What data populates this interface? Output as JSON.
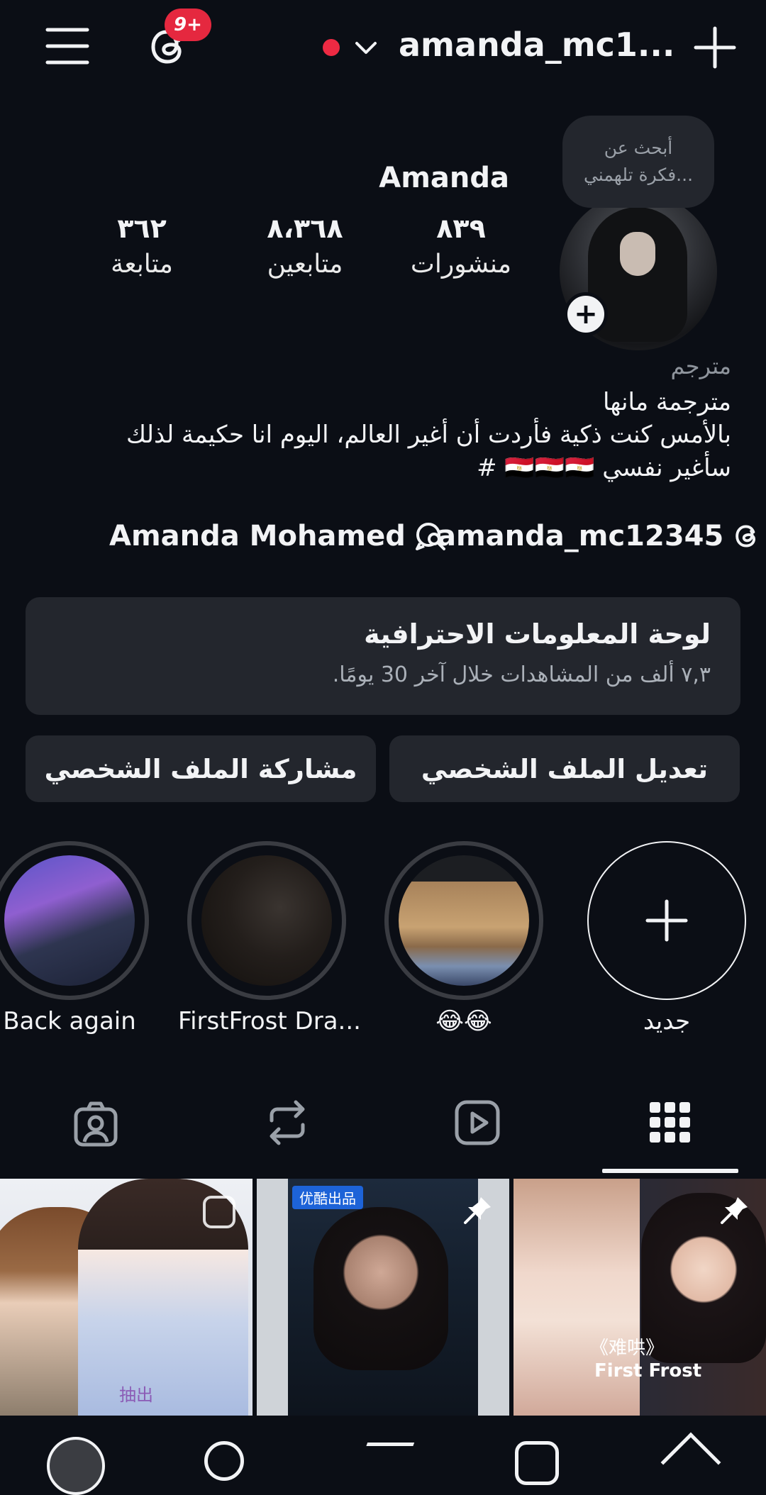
{
  "header": {
    "notification_badge": "9+",
    "username": "amanda_mc1..."
  },
  "note": {
    "line1": "أبحث عن",
    "line2": "فكرة تلهمني..."
  },
  "profile": {
    "display_name": "Amanda",
    "stats": {
      "posts": {
        "value": "٨٣٩",
        "label": "منشورات"
      },
      "followers": {
        "value": "٨،٣٦٨",
        "label": "متابعين"
      },
      "following": {
        "value": "٣٦٢",
        "label": "متابعة"
      }
    },
    "category": "مترجم",
    "bio_line1": "مترجمة مانها",
    "bio_line2": "بالأمس كنت ذكية فأردت أن أغير العالم، اليوم انا حكيمة لذلك",
    "bio_line3": "سأغير نفسي 🇪🇬🇪🇬🇪🇬 #",
    "link_threads": "amanda_mc12345",
    "link_other": "Amanda Mohamed"
  },
  "dashboard": {
    "title": "لوحة المعلومات الاحترافية",
    "subtitle": "٧,٣ ألف من المشاهدات خلال آخر 30 يومًا."
  },
  "buttons": {
    "edit_profile": "تعديل الملف الشخصي",
    "share_profile": "مشاركة الملف الشخصي"
  },
  "highlights": [
    {
      "label": "جديد"
    },
    {
      "label": "😂😂"
    },
    {
      "label": "FirstFrost Dra..."
    },
    {
      "label": "Back again"
    }
  ],
  "posts": [
    {
      "caption": "抽出",
      "pinned": false,
      "type": "reel"
    },
    {
      "caption": "优酷出品",
      "pinned": true,
      "type": "post"
    },
    {
      "caption": "First Frost",
      "pinned": true,
      "type": "post"
    }
  ],
  "posts_extra": {
    "post3_title": "《难哄》"
  },
  "colors": {
    "background": "#0b0e15",
    "card": "#23262d",
    "badge": "#e5283f",
    "text": "#f2f3f5"
  }
}
